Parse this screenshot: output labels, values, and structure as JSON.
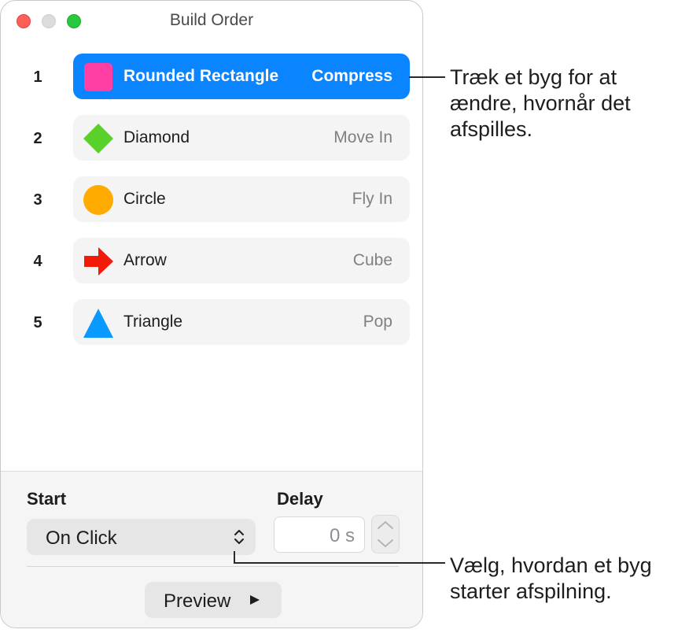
{
  "window": {
    "title": "Build Order"
  },
  "builds": [
    {
      "number": "1",
      "name": "Rounded Rectangle",
      "effect": "Compress",
      "icon": "pink-rounded-square-icon",
      "color": "#ff3fa3",
      "selected": true
    },
    {
      "number": "2",
      "name": "Diamond",
      "effect": "Move In",
      "icon": "green-diamond-icon",
      "color": "#5ad02b",
      "selected": false
    },
    {
      "number": "3",
      "name": "Circle",
      "effect": "Fly In",
      "icon": "orange-circle-icon",
      "color": "#ffab00",
      "selected": false
    },
    {
      "number": "4",
      "name": "Arrow",
      "effect": "Cube",
      "icon": "red-arrow-icon",
      "color": "#f41a0a",
      "selected": false
    },
    {
      "number": "5",
      "name": "Triangle",
      "effect": "Pop",
      "icon": "blue-triangle-icon",
      "color": "#0a9aff",
      "selected": false
    }
  ],
  "controls": {
    "start_label": "Start",
    "start_value": "On Click",
    "delay_label": "Delay",
    "delay_value": "0 s",
    "preview_label": "Preview"
  },
  "callouts": {
    "top": [
      "Træk et byg for at",
      "ændre, hvornår det",
      "afspilles."
    ],
    "bottom": [
      "Vælg, hvordan et byg",
      "starter afspilning."
    ]
  },
  "colors": {
    "accent": "#0a84ff",
    "close": "#ff5f57",
    "maximize": "#28c840"
  }
}
